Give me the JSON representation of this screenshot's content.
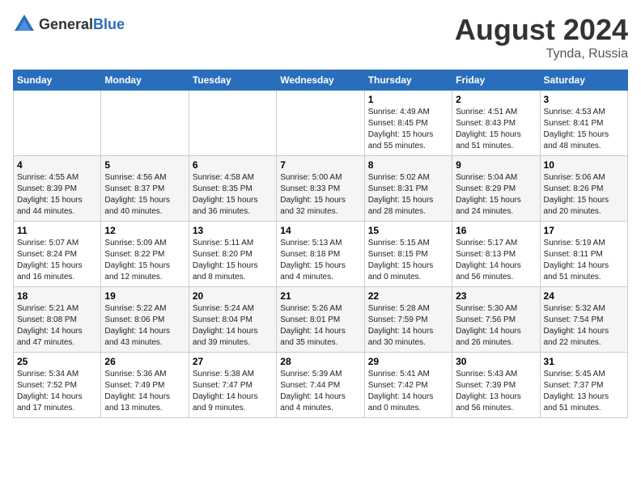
{
  "header": {
    "logo_general": "General",
    "logo_blue": "Blue",
    "title": "August 2024",
    "location": "Tynda, Russia"
  },
  "weekdays": [
    "Sunday",
    "Monday",
    "Tuesday",
    "Wednesday",
    "Thursday",
    "Friday",
    "Saturday"
  ],
  "weeks": [
    [
      {
        "day": "",
        "sunrise": "",
        "sunset": "",
        "daylight": ""
      },
      {
        "day": "",
        "sunrise": "",
        "sunset": "",
        "daylight": ""
      },
      {
        "day": "",
        "sunrise": "",
        "sunset": "",
        "daylight": ""
      },
      {
        "day": "",
        "sunrise": "",
        "sunset": "",
        "daylight": ""
      },
      {
        "day": "1",
        "sunrise": "Sunrise: 4:49 AM",
        "sunset": "Sunset: 8:45 PM",
        "daylight": "Daylight: 15 hours and 55 minutes."
      },
      {
        "day": "2",
        "sunrise": "Sunrise: 4:51 AM",
        "sunset": "Sunset: 8:43 PM",
        "daylight": "Daylight: 15 hours and 51 minutes."
      },
      {
        "day": "3",
        "sunrise": "Sunrise: 4:53 AM",
        "sunset": "Sunset: 8:41 PM",
        "daylight": "Daylight: 15 hours and 48 minutes."
      }
    ],
    [
      {
        "day": "4",
        "sunrise": "Sunrise: 4:55 AM",
        "sunset": "Sunset: 8:39 PM",
        "daylight": "Daylight: 15 hours and 44 minutes."
      },
      {
        "day": "5",
        "sunrise": "Sunrise: 4:56 AM",
        "sunset": "Sunset: 8:37 PM",
        "daylight": "Daylight: 15 hours and 40 minutes."
      },
      {
        "day": "6",
        "sunrise": "Sunrise: 4:58 AM",
        "sunset": "Sunset: 8:35 PM",
        "daylight": "Daylight: 15 hours and 36 minutes."
      },
      {
        "day": "7",
        "sunrise": "Sunrise: 5:00 AM",
        "sunset": "Sunset: 8:33 PM",
        "daylight": "Daylight: 15 hours and 32 minutes."
      },
      {
        "day": "8",
        "sunrise": "Sunrise: 5:02 AM",
        "sunset": "Sunset: 8:31 PM",
        "daylight": "Daylight: 15 hours and 28 minutes."
      },
      {
        "day": "9",
        "sunrise": "Sunrise: 5:04 AM",
        "sunset": "Sunset: 8:29 PM",
        "daylight": "Daylight: 15 hours and 24 minutes."
      },
      {
        "day": "10",
        "sunrise": "Sunrise: 5:06 AM",
        "sunset": "Sunset: 8:26 PM",
        "daylight": "Daylight: 15 hours and 20 minutes."
      }
    ],
    [
      {
        "day": "11",
        "sunrise": "Sunrise: 5:07 AM",
        "sunset": "Sunset: 8:24 PM",
        "daylight": "Daylight: 15 hours and 16 minutes."
      },
      {
        "day": "12",
        "sunrise": "Sunrise: 5:09 AM",
        "sunset": "Sunset: 8:22 PM",
        "daylight": "Daylight: 15 hours and 12 minutes."
      },
      {
        "day": "13",
        "sunrise": "Sunrise: 5:11 AM",
        "sunset": "Sunset: 8:20 PM",
        "daylight": "Daylight: 15 hours and 8 minutes."
      },
      {
        "day": "14",
        "sunrise": "Sunrise: 5:13 AM",
        "sunset": "Sunset: 8:18 PM",
        "daylight": "Daylight: 15 hours and 4 minutes."
      },
      {
        "day": "15",
        "sunrise": "Sunrise: 5:15 AM",
        "sunset": "Sunset: 8:15 PM",
        "daylight": "Daylight: 15 hours and 0 minutes."
      },
      {
        "day": "16",
        "sunrise": "Sunrise: 5:17 AM",
        "sunset": "Sunset: 8:13 PM",
        "daylight": "Daylight: 14 hours and 56 minutes."
      },
      {
        "day": "17",
        "sunrise": "Sunrise: 5:19 AM",
        "sunset": "Sunset: 8:11 PM",
        "daylight": "Daylight: 14 hours and 51 minutes."
      }
    ],
    [
      {
        "day": "18",
        "sunrise": "Sunrise: 5:21 AM",
        "sunset": "Sunset: 8:08 PM",
        "daylight": "Daylight: 14 hours and 47 minutes."
      },
      {
        "day": "19",
        "sunrise": "Sunrise: 5:22 AM",
        "sunset": "Sunset: 8:06 PM",
        "daylight": "Daylight: 14 hours and 43 minutes."
      },
      {
        "day": "20",
        "sunrise": "Sunrise: 5:24 AM",
        "sunset": "Sunset: 8:04 PM",
        "daylight": "Daylight: 14 hours and 39 minutes."
      },
      {
        "day": "21",
        "sunrise": "Sunrise: 5:26 AM",
        "sunset": "Sunset: 8:01 PM",
        "daylight": "Daylight: 14 hours and 35 minutes."
      },
      {
        "day": "22",
        "sunrise": "Sunrise: 5:28 AM",
        "sunset": "Sunset: 7:59 PM",
        "daylight": "Daylight: 14 hours and 30 minutes."
      },
      {
        "day": "23",
        "sunrise": "Sunrise: 5:30 AM",
        "sunset": "Sunset: 7:56 PM",
        "daylight": "Daylight: 14 hours and 26 minutes."
      },
      {
        "day": "24",
        "sunrise": "Sunrise: 5:32 AM",
        "sunset": "Sunset: 7:54 PM",
        "daylight": "Daylight: 14 hours and 22 minutes."
      }
    ],
    [
      {
        "day": "25",
        "sunrise": "Sunrise: 5:34 AM",
        "sunset": "Sunset: 7:52 PM",
        "daylight": "Daylight: 14 hours and 17 minutes."
      },
      {
        "day": "26",
        "sunrise": "Sunrise: 5:36 AM",
        "sunset": "Sunset: 7:49 PM",
        "daylight": "Daylight: 14 hours and 13 minutes."
      },
      {
        "day": "27",
        "sunrise": "Sunrise: 5:38 AM",
        "sunset": "Sunset: 7:47 PM",
        "daylight": "Daylight: 14 hours and 9 minutes."
      },
      {
        "day": "28",
        "sunrise": "Sunrise: 5:39 AM",
        "sunset": "Sunset: 7:44 PM",
        "daylight": "Daylight: 14 hours and 4 minutes."
      },
      {
        "day": "29",
        "sunrise": "Sunrise: 5:41 AM",
        "sunset": "Sunset: 7:42 PM",
        "daylight": "Daylight: 14 hours and 0 minutes."
      },
      {
        "day": "30",
        "sunrise": "Sunrise: 5:43 AM",
        "sunset": "Sunset: 7:39 PM",
        "daylight": "Daylight: 13 hours and 56 minutes."
      },
      {
        "day": "31",
        "sunrise": "Sunrise: 5:45 AM",
        "sunset": "Sunset: 7:37 PM",
        "daylight": "Daylight: 13 hours and 51 minutes."
      }
    ]
  ]
}
